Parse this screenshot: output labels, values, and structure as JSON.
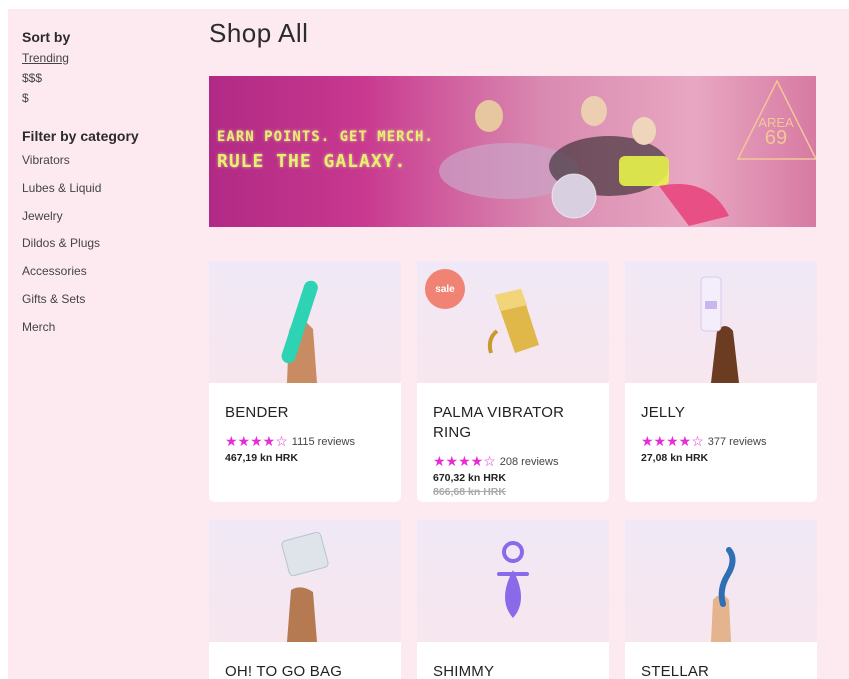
{
  "sidebar": {
    "sort_title": "Sort by",
    "sort_options": [
      "Trending",
      "$$$",
      "$"
    ],
    "filter_title": "Filter by category",
    "categories": [
      "Vibrators",
      "Lubes & Liquid",
      "Jewelry",
      "Dildos & Plugs",
      "Accessories",
      "Gifts & Sets",
      "Merch"
    ]
  },
  "main": {
    "title": "Shop All",
    "banner": {
      "line1": "EARN POINTS. GET MERCH.",
      "line2": "RULE THE GALAXY.",
      "logo_line1": "AREA",
      "logo_line2": "69"
    }
  },
  "products": [
    {
      "name": "BENDER",
      "stars": "★★★★☆",
      "reviews": "1115 reviews",
      "price": "467,19 kn HRK"
    },
    {
      "name": "PALMA VIBRATOR RING",
      "badge": "sale",
      "stars": "★★★★☆",
      "reviews": "208 reviews",
      "price": "670,32 kn HRK",
      "old_price": "866,68 kn HRK"
    },
    {
      "name": "JELLY",
      "stars": "★★★★☆",
      "reviews": "377 reviews",
      "price": "27,08 kn HRK"
    },
    {
      "name": "OH! TO GO BAG"
    },
    {
      "name": "SHIMMY"
    },
    {
      "name": "STELLAR"
    }
  ],
  "colors": {
    "page_bg": "#fdeaf1",
    "star": "#e52cd6",
    "sale_badge": "#f08373",
    "banner_text": "#e8f070"
  }
}
